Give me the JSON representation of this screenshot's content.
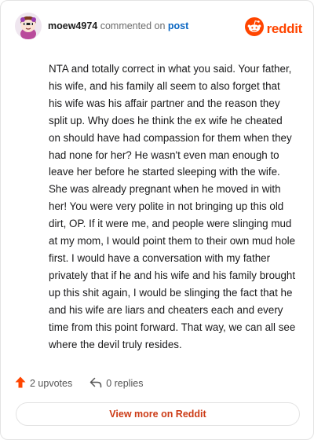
{
  "header": {
    "username": "moew4974",
    "commented_text": " commented on ",
    "post_link": "post",
    "avatar_icon": "snoo-avatar-icon"
  },
  "brand": {
    "logo_text": "reddit",
    "logo_icon": "reddit-alien-icon",
    "accent_color": "#ff4500"
  },
  "comment": {
    "body": "NTA and totally correct in what you said. Your father, his wife, and his family all seem to also forget that his wife was his affair partner and the reason they split up. Why does he think the ex wife he cheated on should have had compassion for them when they had none for her? He wasn't even man enough to leave her before he started sleeping with the wife. She was already pregnant when he moved in with her! You were very polite in not bringing up this old dirt, OP. If it were me, and people were slinging mud at my mom, I would point them to their own mud hole first. I would have a conversation with my father privately that if he and his wife and his family brought up this shit again, I would be slinging the fact that he and his wife are liars and cheaters each and every time from this point forward. That way, we can all see where the devil truly resides."
  },
  "actions": {
    "upvotes_label": "2 upvotes",
    "upvote_icon": "upvote-arrow-icon",
    "replies_label": "0 replies",
    "reply_icon": "reply-icon"
  },
  "footer": {
    "view_more_label": "View more on Reddit",
    "view_more_color": "#cc3b16"
  }
}
